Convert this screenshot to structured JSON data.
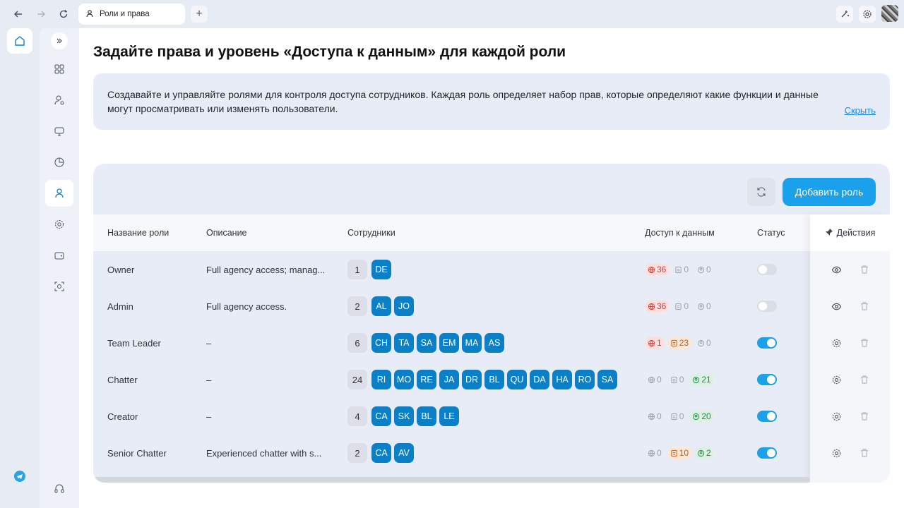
{
  "browser": {
    "tab_title": "Роли и права"
  },
  "page": {
    "title": "Задайте права и уровень «Доступа к данным» для каждой роли",
    "info_text": "Создавайте и управляйте ролями для контроля доступа сотрудников. Каждая роль определяет набор прав, которые определяют какие функции и данные могут просматривать или изменять пользователи.",
    "hide_link": "Скрыть"
  },
  "toolbar": {
    "add_role_label": "Добавить роль"
  },
  "table": {
    "headers": {
      "name": "Название роли",
      "description": "Описание",
      "employees": "Сотрудники",
      "data_access": "Доступ к данным",
      "status": "Статус",
      "actions": "Действия"
    },
    "rows": [
      {
        "name": "Owner",
        "description": "Full agency access; manag...",
        "count": "1",
        "employees": [
          "DE"
        ],
        "access": [
          {
            "v": "36",
            "c": "red",
            "i": "globe"
          },
          {
            "v": "0",
            "c": "grey",
            "i": "card"
          },
          {
            "v": "0",
            "c": "grey",
            "i": "user"
          }
        ],
        "status": "off",
        "action": "view"
      },
      {
        "name": "Admin",
        "description": "Full agency access.",
        "count": "2",
        "employees": [
          "AL",
          "JO"
        ],
        "access": [
          {
            "v": "36",
            "c": "red",
            "i": "globe"
          },
          {
            "v": "0",
            "c": "grey",
            "i": "card"
          },
          {
            "v": "0",
            "c": "grey",
            "i": "user"
          }
        ],
        "status": "off",
        "action": "view"
      },
      {
        "name": "Team Leader",
        "description": "–",
        "count": "6",
        "employees": [
          "CH",
          "TA",
          "SA",
          "EM",
          "MA",
          "AS"
        ],
        "access": [
          {
            "v": "1",
            "c": "red",
            "i": "globe"
          },
          {
            "v": "23",
            "c": "orange",
            "i": "card"
          },
          {
            "v": "0",
            "c": "grey",
            "i": "user"
          }
        ],
        "status": "on",
        "action": "settings"
      },
      {
        "name": "Chatter",
        "description": "–",
        "count": "24",
        "employees": [
          "RI",
          "MO",
          "RE",
          "JA",
          "DR",
          "BL",
          "QU",
          "DA",
          "HA",
          "RO",
          "SA"
        ],
        "access": [
          {
            "v": "0",
            "c": "grey",
            "i": "globe"
          },
          {
            "v": "0",
            "c": "grey",
            "i": "card"
          },
          {
            "v": "21",
            "c": "green",
            "i": "user"
          }
        ],
        "status": "on",
        "action": "settings"
      },
      {
        "name": "Creator",
        "description": "–",
        "count": "4",
        "employees": [
          "CA",
          "SK",
          "BL",
          "LE"
        ],
        "access": [
          {
            "v": "0",
            "c": "grey",
            "i": "globe"
          },
          {
            "v": "0",
            "c": "grey",
            "i": "card"
          },
          {
            "v": "20",
            "c": "green",
            "i": "user"
          }
        ],
        "status": "on",
        "action": "settings"
      },
      {
        "name": "Senior Chatter",
        "description": "Experienced chatter with s...",
        "count": "2",
        "employees": [
          "CA",
          "AV"
        ],
        "access": [
          {
            "v": "0",
            "c": "grey",
            "i": "globe"
          },
          {
            "v": "10",
            "c": "orange",
            "i": "card"
          },
          {
            "v": "2",
            "c": "green",
            "i": "user"
          }
        ],
        "status": "on",
        "action": "settings"
      }
    ]
  },
  "colors": {
    "accent": "#1ba0ec",
    "employee_chip": "#0b80c6"
  }
}
